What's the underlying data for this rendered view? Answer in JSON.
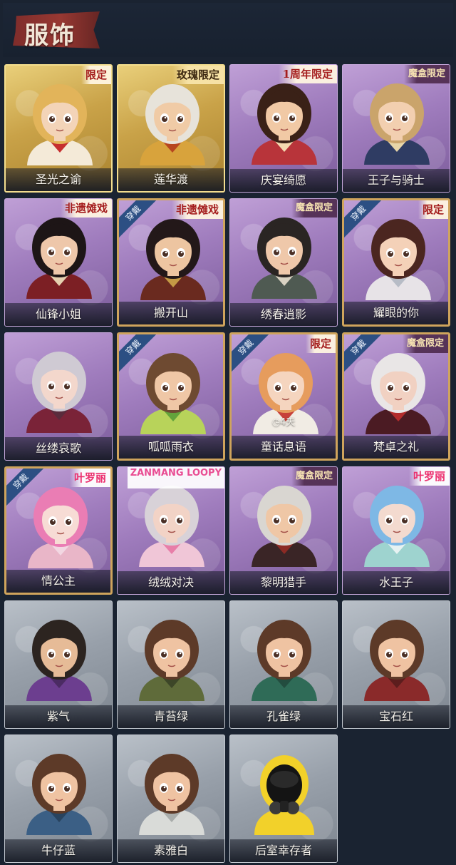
{
  "header": {
    "title": "服饰"
  },
  "colors": {
    "background": "#1a2331",
    "gold_rarity": "#c9a248",
    "purple_rarity": "#9f7cbd",
    "gray_rarity": "#98a0aa",
    "equipped_ribbon": "#2c4f83",
    "limited_badge_text": "#a41d1d"
  },
  "costumes": [
    {
      "name": "圣光之谕",
      "rarity": "gold",
      "badge": "限定",
      "badge_style": "red",
      "equipped": false,
      "hair": "#e2b45a",
      "skin": "#f3d4b8",
      "outfit": "#f4ead8",
      "accent": "#c62f2f"
    },
    {
      "name": "莲华渡",
      "rarity": "gold",
      "badge": "玫瑰限定",
      "badge_style": "gold",
      "equipped": false,
      "hair": "#e7e3da",
      "skin": "#f0cba6",
      "outfit": "#d8a33c",
      "accent": "#b7461f"
    },
    {
      "name": "庆宴绮愿",
      "rarity": "purple",
      "badge": "1周年限定",
      "badge_style": "red",
      "equipped": false,
      "hair": "#3a2117",
      "skin": "#f1c9a5",
      "outfit": "#b8343a",
      "accent": "#f4d9b0"
    },
    {
      "name": "王子与骑士",
      "rarity": "purple",
      "badge": "魔盒限定",
      "badge_style": "box",
      "equipped": false,
      "hair": "#caa46b",
      "skin": "#f2cfb0",
      "outfit": "#2f3c63",
      "accent": "#e7d5a8"
    },
    {
      "name": "仙锋小姐",
      "rarity": "purple",
      "badge": "非遗傩戏",
      "badge_style": "red",
      "equipped": false,
      "hair": "#1d1516",
      "skin": "#eec7aa",
      "outfit": "#7c1f24",
      "accent": "#e6d1b0"
    },
    {
      "name": "搬开山",
      "rarity": "purple",
      "badge": "非遗傩戏",
      "badge_style": "red",
      "equipped": true,
      "ribbon": "穿戴",
      "hair": "#231819",
      "skin": "#edc5a1",
      "outfit": "#6a2a1f",
      "accent": "#c49a45"
    },
    {
      "name": "绣春逍影",
      "rarity": "purple",
      "badge": "魔盒限定",
      "badge_style": "box",
      "equipped": false,
      "hair": "#2a2523",
      "skin": "#efc8aa",
      "outfit": "#4f5a52",
      "accent": "#d9d2c2"
    },
    {
      "name": "耀眼的你",
      "rarity": "purple",
      "badge": "限定",
      "badge_style": "red",
      "equipped": true,
      "ribbon": "穿戴",
      "hair": "#4b2620",
      "skin": "#f4d1b8",
      "outfit": "#e7e3e7",
      "accent": "#b7bcc6"
    },
    {
      "name": "丝缕哀歌",
      "rarity": "purple",
      "badge": "",
      "badge_style": "",
      "equipped": false,
      "hair": "#cfcad3",
      "skin": "#f3d7cc",
      "outfit": "#7a2338",
      "accent": "#5a2b3c"
    },
    {
      "name": "呱呱雨衣",
      "rarity": "purple",
      "badge": "",
      "badge_style": "",
      "equipped": true,
      "ribbon": "穿戴",
      "hair": "#6e4a31",
      "skin": "#efc7a6",
      "outfit": "#b8d35a",
      "accent": "#63a43b"
    },
    {
      "name": "童话息语",
      "rarity": "purple",
      "badge": "限定",
      "badge_style": "red",
      "equipped": true,
      "ribbon": "穿戴",
      "timer": "4天",
      "hair": "#e69c5d",
      "skin": "#f5d5bf",
      "outfit": "#f1ece4",
      "accent": "#c7413a"
    },
    {
      "name": "梵卓之礼",
      "rarity": "purple",
      "badge": "魔盒限定",
      "badge_style": "box",
      "equipped": true,
      "ribbon": "穿戴",
      "hair": "#e9e6e6",
      "skin": "#f1d1c2",
      "outfit": "#4b1b23",
      "accent": "#b22c2c"
    },
    {
      "name": "情公主",
      "rarity": "purple",
      "badge": "叶罗丽",
      "badge_style": "pink",
      "equipped": true,
      "ribbon": "穿戴",
      "hair": "#ea7db4",
      "skin": "#f7dcd5",
      "outfit": "#e9b6c8",
      "accent": "#f2d7e2"
    },
    {
      "name": "绒绒对决",
      "rarity": "purple",
      "badge": "ZANMANG LOOPY",
      "badge_style": "loopy",
      "equipped": false,
      "hair": "#d8d2d8",
      "skin": "#f2d3c6",
      "outfit": "#f0c6d7",
      "accent": "#e87ea8"
    },
    {
      "name": "黎明猎手",
      "rarity": "purple",
      "badge": "魔盒限定",
      "badge_style": "box",
      "equipped": false,
      "hair": "#d9d6d1",
      "skin": "#efc7a6",
      "outfit": "#3a2526",
      "accent": "#8c2a24"
    },
    {
      "name": "水王子",
      "rarity": "purple",
      "badge": "叶罗丽",
      "badge_style": "pink",
      "equipped": false,
      "hair": "#7eb8e5",
      "skin": "#f3dacf",
      "outfit": "#9ed3cf",
      "accent": "#e7f2f2"
    },
    {
      "name": "紫气",
      "rarity": "gray",
      "badge": "",
      "badge_style": "",
      "equipped": false,
      "hair": "#2c2420",
      "skin": "#e6bb97",
      "outfit": "#6c3e8f",
      "accent": "#4b2b63"
    },
    {
      "name": "青苔绿",
      "rarity": "gray",
      "badge": "",
      "badge_style": "",
      "equipped": false,
      "hair": "#5d3a28",
      "skin": "#efc3a2",
      "outfit": "#5f6b3a",
      "accent": "#3d4628"
    },
    {
      "name": "孔雀绿",
      "rarity": "gray",
      "badge": "",
      "badge_style": "",
      "equipped": false,
      "hair": "#5d3a28",
      "skin": "#efc3a2",
      "outfit": "#2f6b57",
      "accent": "#234c3f"
    },
    {
      "name": "宝石红",
      "rarity": "gray",
      "badge": "",
      "badge_style": "",
      "equipped": false,
      "hair": "#5d3a28",
      "skin": "#efc3a2",
      "outfit": "#8a2a2a",
      "accent": "#5c1d1d"
    },
    {
      "name": "牛仔蓝",
      "rarity": "gray",
      "badge": "",
      "badge_style": "",
      "equipped": false,
      "hair": "#5d3a28",
      "skin": "#efc3a2",
      "outfit": "#3b5f85",
      "accent": "#28435f"
    },
    {
      "name": "素雅白",
      "rarity": "gray",
      "badge": "",
      "badge_style": "",
      "equipped": false,
      "hair": "#5d3a28",
      "skin": "#efc3a2",
      "outfit": "#d9dbd8",
      "accent": "#a9adab"
    },
    {
      "name": "后室幸存者",
      "rarity": "gray",
      "badge": "",
      "badge_style": "",
      "equipped": false,
      "hazmat": true,
      "hair": "#1b1b1b",
      "skin": "#1b1b1b",
      "outfit": "#f2d12a",
      "accent": "#c7a418"
    }
  ]
}
